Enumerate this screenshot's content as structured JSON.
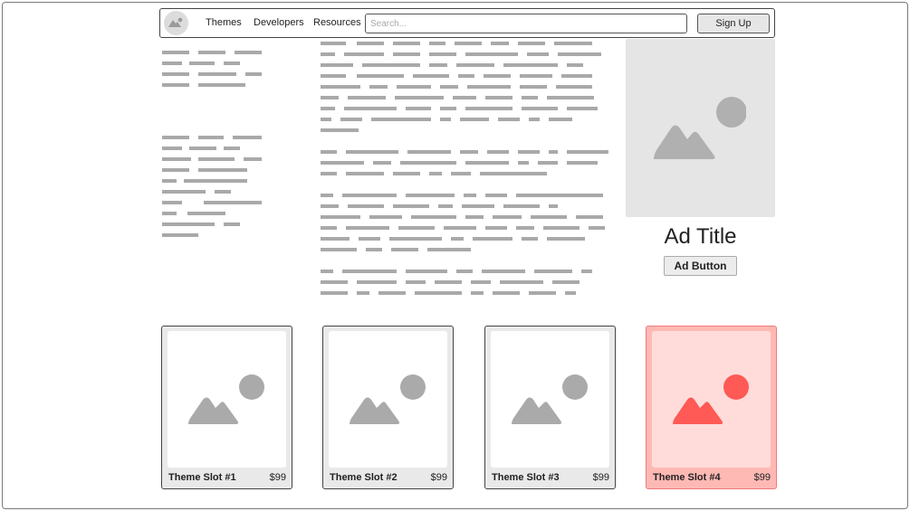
{
  "header": {
    "nav": [
      "Themes",
      "Developers",
      "Resources"
    ],
    "search_placeholder": "Search...",
    "signup_label": "Sign Up"
  },
  "ad": {
    "title": "Ad Title",
    "button_label": "Ad Button"
  },
  "themes": [
    {
      "name": "Theme Slot #1",
      "price": "$99"
    },
    {
      "name": "Theme Slot #2",
      "price": "$99"
    },
    {
      "name": "Theme Slot #3",
      "price": "$99"
    },
    {
      "name": "Theme Slot #4",
      "price": "$99",
      "highlighted": true
    }
  ],
  "colors": {
    "placeholder_gray": "#a9a9a9",
    "highlight_accent": "#ff5a55",
    "highlight_bg": "#ffb9b5"
  }
}
